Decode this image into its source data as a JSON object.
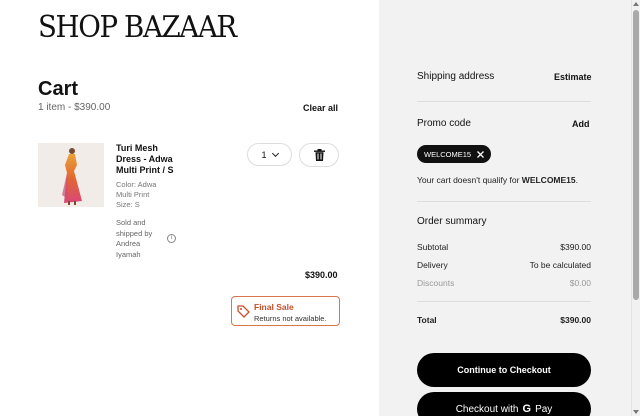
{
  "brand": {
    "logo_text": "SHOP BAZAAR"
  },
  "cart": {
    "title": "Cart",
    "summary": "1 item - $390.00",
    "clear_all": "Clear all",
    "items": [
      {
        "name": "Turi Mesh Dress - Adwa Multi Print / S",
        "color": "Color: Adwa Multi Print",
        "size": "Size: S",
        "sold_by": "Sold and shipped by Andrea Iyamah",
        "quantity": "1",
        "price": "$390.00",
        "final_sale_title": "Final Sale",
        "final_sale_sub": "Returns not available."
      }
    ]
  },
  "sidebar": {
    "shipping_label": "Shipping address",
    "shipping_action": "Estimate",
    "promo_label": "Promo code",
    "promo_action": "Add",
    "promo_code": "WELCOME15",
    "promo_msg_prefix": "Your cart doesn't qualify for ",
    "promo_msg_code": "WELCOME15",
    "promo_msg_suffix": ".",
    "order_summary_label": "Order summary",
    "subtotal_label": "Subtotal",
    "subtotal_value": "$390.00",
    "delivery_label": "Delivery",
    "delivery_value": "To be calculated",
    "discounts_label": "Discounts",
    "discounts_value": "$0.00",
    "total_label": "Total",
    "total_value": "$390.00",
    "checkout_button": "Continue to Checkout",
    "gpay_prefix": "Checkout with",
    "gpay_g": "G",
    "gpay_suffix": "Pay"
  },
  "colors": {
    "final_sale_accent": "#c4502a",
    "sidebar_bg": "#f2f2f2",
    "primary_button": "#000000"
  }
}
